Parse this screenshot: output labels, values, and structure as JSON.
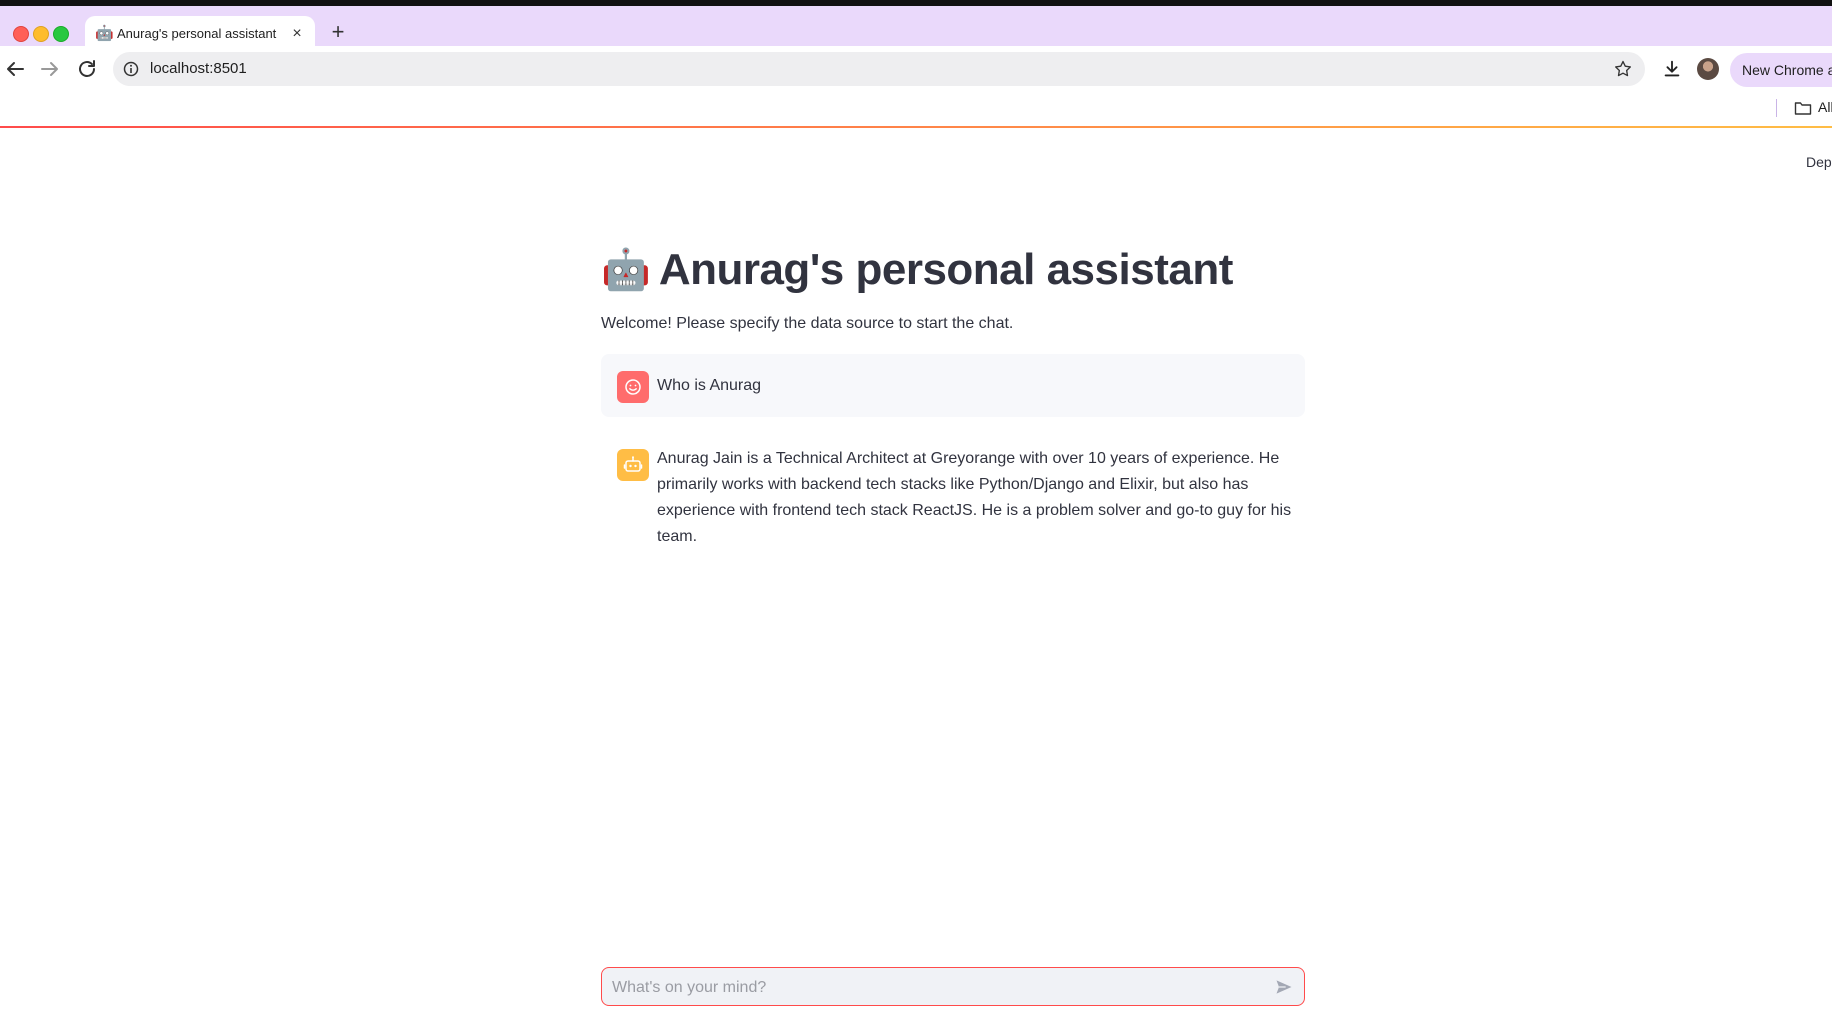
{
  "browser": {
    "tab_title": "Anurag's personal assistant",
    "url": "localhost:8501",
    "profile_button_label": "New Chrome a",
    "bookmarks_label": "All"
  },
  "app": {
    "deploy_label": "Depl",
    "title": "Anurag's personal assistant",
    "welcome_text": "Welcome! Please specify the data source to start the chat."
  },
  "messages": [
    {
      "role": "user",
      "text": "Who is Anurag"
    },
    {
      "role": "assistant",
      "text": "Anurag Jain is a Technical Architect at Greyorange with over 10 years of experience. He primarily works with backend tech stacks like Python/Django and Elixir, but also has experience with frontend tech stack ReactJS. He is a problem solver and go-to guy for his team."
    }
  ],
  "chat_input": {
    "placeholder": "What's on your mind?",
    "value": ""
  },
  "colors": {
    "tab_bar": "#ead9fb",
    "user_avatar": "#ff6c6c",
    "assistant_avatar": "#ffbd45",
    "input_border": "#ff4b4b"
  },
  "icons": {
    "title_emoji": "robot-face",
    "user_avatar": "smiley-icon",
    "assistant_avatar": "robot-icon"
  }
}
